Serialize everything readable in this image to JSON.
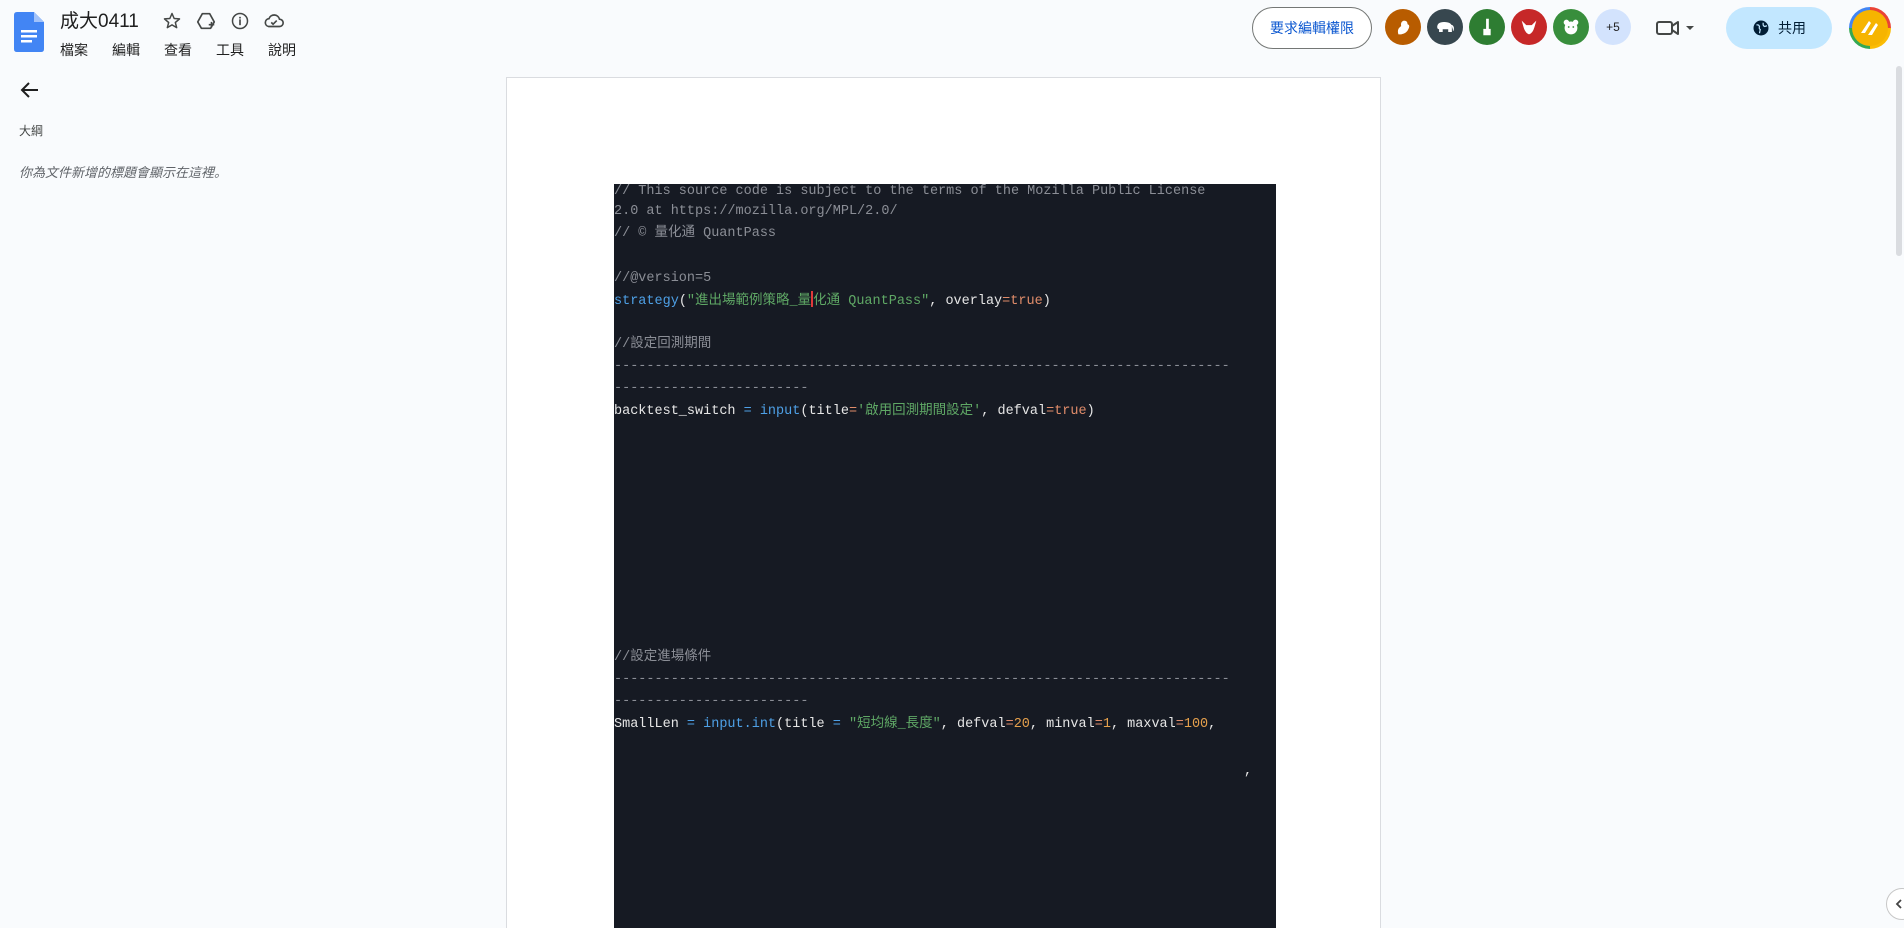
{
  "header": {
    "title": "成大0411",
    "menu": [
      "檔案",
      "編輯",
      "查看",
      "工具",
      "說明"
    ],
    "request_button": "要求編輯權限",
    "share_button": "共用",
    "more_avatars": "+5",
    "avatars": [
      {
        "icon": "squirrel-icon",
        "color": "#b85c00"
      },
      {
        "icon": "elephant-icon",
        "color": "#37474f"
      },
      {
        "icon": "giraffe-icon",
        "color": "#2e7d32"
      },
      {
        "icon": "buffalo-icon",
        "color": "#c62828"
      },
      {
        "icon": "bear-icon",
        "color": "#388e3c"
      }
    ]
  },
  "sidebar": {
    "outline_label": "大綱",
    "outline_hint": "你為文件新增的標題會顯示在這裡。"
  },
  "code": {
    "l1": "// This source code is subject to the terms of the Mozilla Public License",
    "l2": "2.0 at https://mozilla.org/MPL/2.0/",
    "l3": "// © 量化通 QuantPass",
    "l4": "//@version=5",
    "l5a": "strategy",
    "l5b": "(",
    "l5c": "\"進出場範例策略_量",
    "l5d": "化通 QuantPass\"",
    "l5e": ", overlay",
    "l5f": "=",
    "l5g": "true",
    "l5h": ")",
    "l6": "//設定回測期間",
    "dash1": "----------------------------------------------------------------------------",
    "dash2": "------------------------",
    "l7a": "backtest_switch ",
    "l7b": "= ",
    "l7c": "input",
    "l7d": "(title",
    "l7e": "=",
    "l7f": "'啟用回測期間設定'",
    "l7g": ", defval",
    "l7h": "=",
    "l7i": "true",
    "l7j": ")",
    "l8": "//設定進場條件",
    "l9a": "SmallLen ",
    "l9b": "= ",
    "l9c": "input.int",
    "l9d": "(title ",
    "l9e": "= ",
    "l9f": "\"短均線_長度\"",
    "l9g": ", defval",
    "l9h": "=",
    "l9i": "20",
    "l9j": ", minval",
    "l9k": "=",
    "l9l": "1",
    "l9m": ", maxval",
    "l9n": "=",
    "l9o": "100",
    "l9p": ",",
    "stray_comma": ","
  }
}
